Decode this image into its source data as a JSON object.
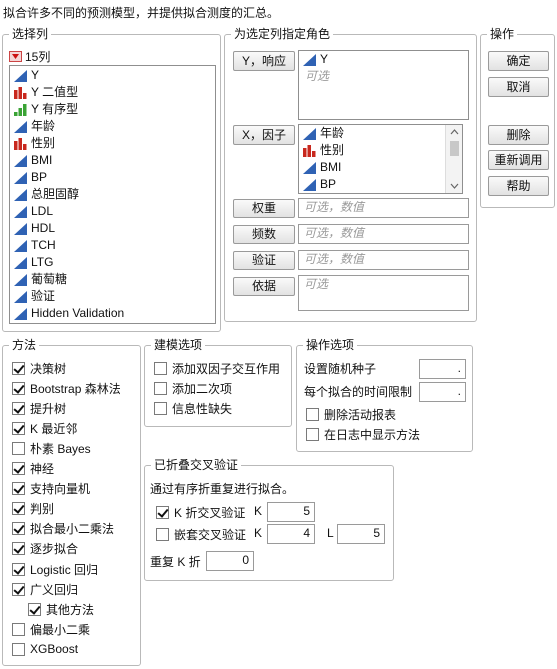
{
  "header_text": "拟合许多不同的预测模型，并提供拟合测度的汇总。",
  "select_columns": {
    "title": "选择列",
    "count_label": "15列",
    "columns": [
      {
        "name": "Y",
        "type": "continuous"
      },
      {
        "name": "Y 二值型",
        "type": "nominal"
      },
      {
        "name": "Y 有序型",
        "type": "ordinal"
      },
      {
        "name": "年龄",
        "type": "continuous"
      },
      {
        "name": "性别",
        "type": "nominal"
      },
      {
        "name": "BMI",
        "type": "continuous"
      },
      {
        "name": "BP",
        "type": "continuous"
      },
      {
        "name": "总胆固醇",
        "type": "continuous"
      },
      {
        "name": "LDL",
        "type": "continuous"
      },
      {
        "name": "HDL",
        "type": "continuous"
      },
      {
        "name": "TCH",
        "type": "continuous"
      },
      {
        "name": "LTG",
        "type": "continuous"
      },
      {
        "name": "葡萄糖",
        "type": "continuous"
      },
      {
        "name": "验证",
        "type": "continuous"
      },
      {
        "name": "Hidden Validation",
        "type": "continuous"
      }
    ]
  },
  "role_panel": {
    "title": "为选定列指定角色",
    "y_label": "Y，响应",
    "y_items": [
      "Y"
    ],
    "y_optional": "可选",
    "x_label": "X，因子",
    "x_items": [
      {
        "name": "年龄",
        "type": "continuous"
      },
      {
        "name": "性别",
        "type": "nominal"
      },
      {
        "name": "BMI",
        "type": "continuous"
      },
      {
        "name": "BP",
        "type": "continuous"
      }
    ],
    "weight_label": "权重",
    "weight_placeholder": "可选，数值",
    "freq_label": "频数",
    "freq_placeholder": "可选，数值",
    "validation_label": "验证",
    "validation_placeholder": "可选，数值",
    "by_label": "依据",
    "by_placeholder": "可选"
  },
  "actions": {
    "title": "操作",
    "ok": "确定",
    "cancel": "取消",
    "remove": "删除",
    "recall": "重新调用",
    "help": "帮助"
  },
  "methods": {
    "title": "方法",
    "items": [
      {
        "label": "决策树",
        "checked": true
      },
      {
        "label": "Bootstrap 森林法",
        "checked": true
      },
      {
        "label": "提升树",
        "checked": true
      },
      {
        "label": "K 最近邻",
        "checked": true
      },
      {
        "label": "朴素 Bayes",
        "checked": false
      },
      {
        "label": "神经",
        "checked": true
      },
      {
        "label": "支持向量机",
        "checked": true
      },
      {
        "label": "判别",
        "checked": true
      },
      {
        "label": "拟合最小二乘法",
        "checked": true
      },
      {
        "label": "逐步拟合",
        "checked": true
      },
      {
        "label": "Logistic 回归",
        "checked": true
      },
      {
        "label": "广义回归",
        "checked": true
      },
      {
        "label": "其他方法",
        "checked": true,
        "indent": true
      },
      {
        "label": "偏最小二乘",
        "checked": false
      },
      {
        "label": "XGBoost",
        "checked": false
      }
    ]
  },
  "modeling_options": {
    "title": "建模选项",
    "items": [
      {
        "label": "添加双因子交互作用",
        "checked": false
      },
      {
        "label": "添加二次项",
        "checked": false
      },
      {
        "label": "信息性缺失",
        "checked": false
      }
    ]
  },
  "operation_options": {
    "title": "操作选项",
    "seed_label": "设置随机种子",
    "seed_value": ".",
    "time_label": "每个拟合的时间限制",
    "time_value": ".",
    "delete_reports_label": "删除活动报表",
    "delete_reports_checked": false,
    "log_label": "在日志中显示方法",
    "log_checked": false
  },
  "kfold": {
    "title": "已折叠交叉验证",
    "description": "通过有序折重复进行拟合。",
    "kfold_label": "K 折交叉验证",
    "kfold_checked": true,
    "kfold_k_label": "K",
    "kfold_k_value": "5",
    "nested_label": "嵌套交叉验证",
    "nested_checked": false,
    "nested_k_label": "K",
    "nested_k_value": "4",
    "nested_l_label": "L",
    "nested_l_value": "5",
    "repeat_label": "重复 K 折",
    "repeat_value": "0"
  }
}
